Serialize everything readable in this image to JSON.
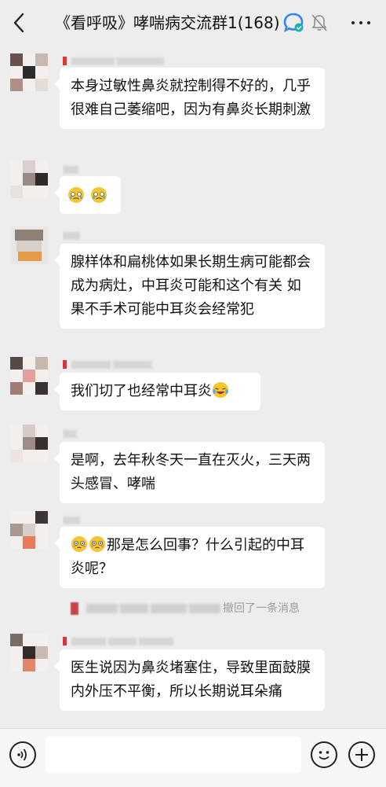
{
  "header": {
    "title": "《看呼吸》哮喘病交流群1(168)",
    "icons": [
      "back-arrow-icon",
      "group-badge-icon",
      "mute-bell-icon",
      "more-dots-icon"
    ]
  },
  "messages": [
    {
      "text": "本身过敏性鼻炎就控制得不好的，几乎很难自己萎缩吧，因为有鼻炎长期刺激"
    },
    {
      "text": "",
      "emojis": [
        "teary-face",
        "teary-face"
      ]
    },
    {
      "text": "腺样体和扁桃体如果长期生病可能都会成为病灶，中耳炎可能和这个有关 如果不手术可能中耳炎会经常犯"
    },
    {
      "text": "我们切了也经常中耳炎",
      "emojis_after": [
        "laugh-cry-face"
      ]
    },
    {
      "text": "是啊，去年秋冬天一直在灭火，三天两头感冒、哮喘"
    },
    {
      "text": "那是怎么回事？什么引起的中耳炎呢？",
      "emojis_before": [
        "flushed-face",
        "flushed-face"
      ]
    },
    {
      "text": "医生说因为鼻炎堵塞住，导致里面鼓膜内外压不平衡，所以长期说耳朵痛"
    }
  ],
  "recall_notice": {
    "text": "撤回了一条消息"
  },
  "colors": {
    "background": "#ededed",
    "bubble": "#ffffff",
    "name_mark": "#d23b3b",
    "recall_text": "#9b9b9b"
  }
}
